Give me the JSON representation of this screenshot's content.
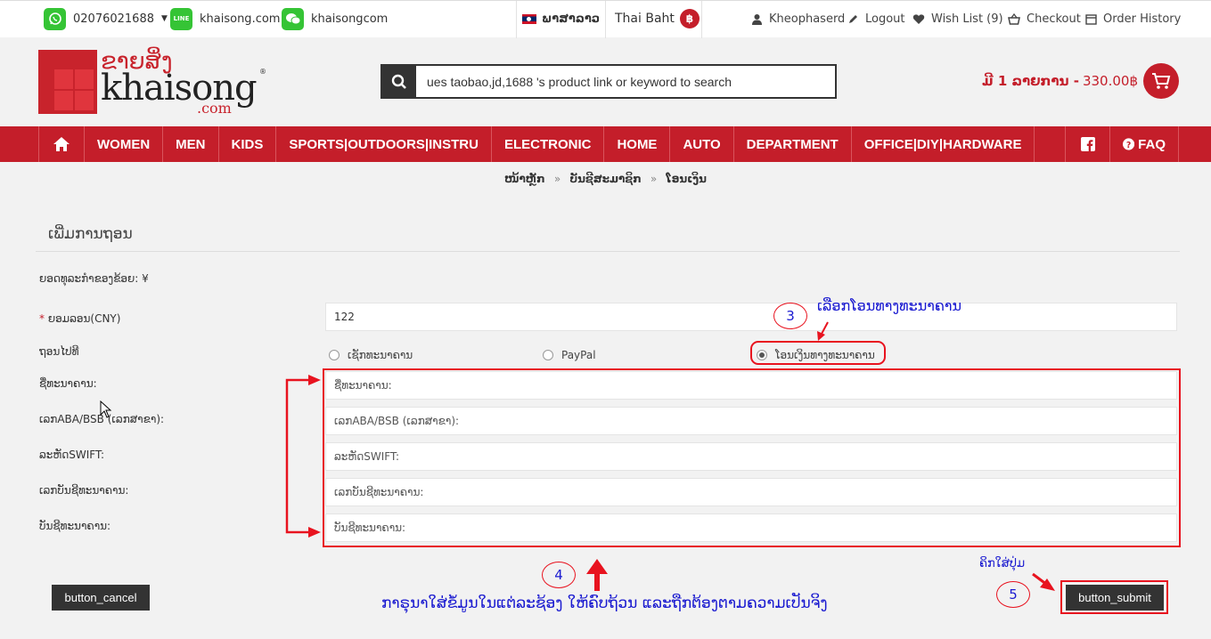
{
  "topbar": {
    "phone": "02076021688",
    "line_id": "khaisong.com",
    "wechat_id": "khaisongcom",
    "language": "ພາສາລາວ",
    "currency": "Thai Baht",
    "currency_symbol": "฿",
    "user": "Kheophaserd",
    "logout": "Logout",
    "wishlist": "Wish List (9)",
    "checkout": "Checkout",
    "order_history": "Order History",
    "line_icon_text": "LINE"
  },
  "header": {
    "logo_lao": "ຂາຍສິ່ງ",
    "logo_main": "khaisong",
    "logo_com": ".com",
    "logo_reg": "®",
    "search_placeholder": "ues taobao,jd,1688 's product link or keyword to search",
    "cart_count": "ມີ 1 ລາຍການ -",
    "cart_total": "330.00฿"
  },
  "nav": {
    "items": [
      "WOMEN",
      "MEN",
      "KIDS",
      "SPORTS|OUTDOORS|INSTRU",
      "ELECTRONIC",
      "HOME",
      "AUTO",
      "DEPARTMENT",
      "OFFICE|DIY|HARDWARE"
    ],
    "faq": "FAQ"
  },
  "breadcrumb": [
    "ໜ້າຫຼັກ",
    "ບັນຊີສະມາຊິກ",
    "ໂອນເງິນ"
  ],
  "form": {
    "title": "ເພີ່ມການຖອນ",
    "balance_label": "ຍອດທຸລະກໍາຂອງຂ້ອຍ: ¥",
    "amount_label": "ຍອມລອນ(CNY)",
    "amount_required": "*",
    "amount_value": "122",
    "withdraw_to_label": "ຖອນໄປທີ",
    "options": [
      "ເຊັກທະນາຄານ",
      "PayPal",
      "ໂອນເງິນທາງທະນາຄານ"
    ],
    "fields": [
      {
        "label": "ຊື່ທະນາຄານ:",
        "placeholder": "ຊື່ທະນາຄານ:"
      },
      {
        "label": "ເລກABA/BSB (ເລກສາຂາ):",
        "placeholder": "ເລກABA/BSB (ເລກສາຂາ):"
      },
      {
        "label": "ລະຫັດSWIFT:",
        "placeholder": "ລະຫັດSWIFT:"
      },
      {
        "label": "ເລກບັນຊີທະນາຄານ:",
        "placeholder": "ເລກບັນຊີທະນາຄານ:"
      },
      {
        "label": "ບັນຊີທະນາຄານ:",
        "placeholder": "ບັນຊີທະນາຄານ:"
      }
    ],
    "cancel": "button_cancel",
    "submit": "button_submit"
  },
  "annotations": {
    "step3": "3",
    "step3_text": "ເລືອກໂອນທາງທະນາຄານ",
    "step4": "4",
    "step4_text": "ກາຣຸນາໃສ່ຂໍ້ມູນໃນແຕ່ລະຊ້ອງ ໃຫ້ຄົບຖ້ວນ ແລະຖືກຕ້ອງຕາມຄວາມເປັນຈິງ",
    "step5": "5",
    "step5_text": "ຄິກໃສ່ປຸ່ມ",
    "color": "#1a1ad0",
    "highlight": "#e8131f"
  },
  "colors": {
    "brand": "#c41e2a",
    "nav_bg": "#c41e2a",
    "button": "#333333"
  }
}
